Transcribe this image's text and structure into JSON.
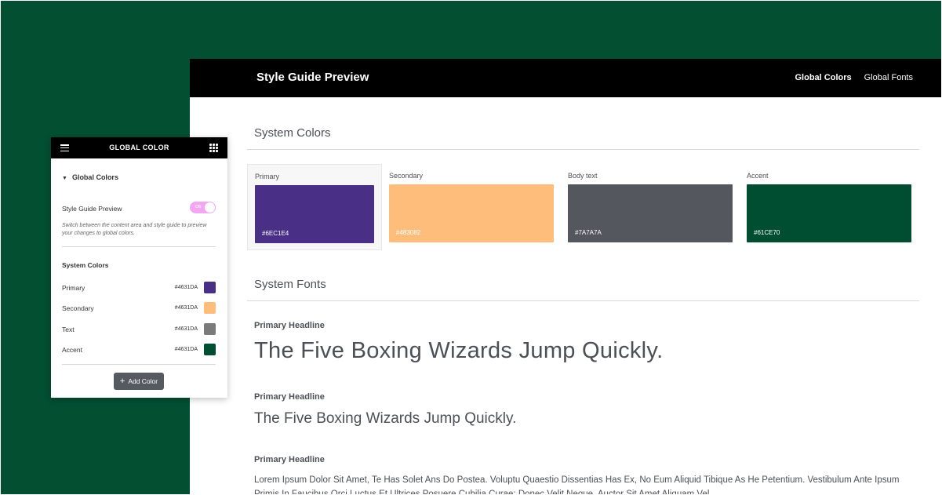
{
  "preview": {
    "title": "Style Guide Preview",
    "nav": [
      "Global Colors",
      "Global Fonts"
    ],
    "system_colors_title": "System Colors",
    "swatches": [
      {
        "name": "Primary",
        "hex": "#6EC1E4",
        "color": "#4a2f86"
      },
      {
        "name": "Secondary",
        "hex": "#483082",
        "color": "#ffbd7c"
      },
      {
        "name": "Body text",
        "hex": "#7A7A7A",
        "color": "#54575e"
      },
      {
        "name": "Accent",
        "hex": "#61CE70",
        "color": "#004e32"
      }
    ],
    "system_fonts_title": "System Fonts",
    "fonts": [
      {
        "label": "Primary Headline",
        "sample": "The Five Boxing Wizards Jump Quickly."
      },
      {
        "label": "Primary Headline",
        "sample": "The Five Boxing Wizards Jump Quickly."
      },
      {
        "label": "Primary Headline",
        "sample": "Lorem Ipsum Dolor Sit Amet, Te Has Solet Ans Do Postea. Voluptu Quaestio Dissentias Has Ex, No Eum Aliquid Tibique As He Petentium. Vestibulum Ante Ipsum Primis In Faucibus Orci Luctus Et Ultrices Posuere Cubilia Curae; Donec Velit Neque, Auctor Sit Amet Aliquam Vel"
      }
    ]
  },
  "panel": {
    "title": "GLOBAL COLOR",
    "section": "Global Colors",
    "toggle_label": "Style Guide Preview",
    "toggle_state": "ON",
    "help": "Switch between the content area and style guide to preview your changes to global colors.",
    "system_colors_label": "System Colors",
    "rows": [
      {
        "name": "Primary",
        "hex": "#4631DA",
        "color": "#4a2f86"
      },
      {
        "name": "Secondary",
        "hex": "#4631DA",
        "color": "#ffbd7c"
      },
      {
        "name": "Text",
        "hex": "#4631DA",
        "color": "#7a7a7a"
      },
      {
        "name": "Accent",
        "hex": "#4631DA",
        "color": "#004e32"
      }
    ],
    "add_button": "Add Color"
  },
  "colors": {
    "background": "#024f32",
    "header": "#000000",
    "toggle": "#f3a6f1"
  }
}
